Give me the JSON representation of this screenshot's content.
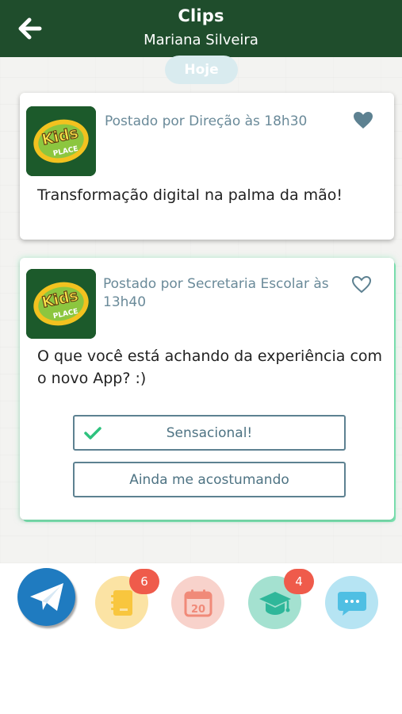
{
  "header": {
    "title": "Clips",
    "subtitle": "Mariana Silveira"
  },
  "feed": {
    "date_separator": "Hoje",
    "posts": [
      {
        "meta": "Postado por Direção às 18h30",
        "text": "Transformação digital na palma da mão!",
        "liked": true
      },
      {
        "meta": "Postado por Secretaria Escolar às 13h40",
        "text": "O que você está achando da experiência com o novo App? :)",
        "liked": false,
        "options": [
          {
            "label": "Sensacional!",
            "selected": true
          },
          {
            "label": "Ainda me acostumando",
            "selected": false
          }
        ]
      }
    ]
  },
  "logo_text": {
    "line1": "Kids",
    "line2": "PLACE"
  },
  "bottom_nav": {
    "items": [
      {
        "icon": "paper-plane-icon"
      },
      {
        "icon": "notebook-icon",
        "badge": "6"
      },
      {
        "icon": "calendar-icon",
        "day": "20"
      },
      {
        "icon": "graduation-cap-icon",
        "badge": "4"
      },
      {
        "icon": "chat-bubble-icon"
      }
    ]
  },
  "colors": {
    "header_bg": "#1f4d2c",
    "accent_green": "#7ee8b5",
    "meta_text": "#6a8a99",
    "badge": "#ef5b4b",
    "check": "#2ec27e"
  }
}
